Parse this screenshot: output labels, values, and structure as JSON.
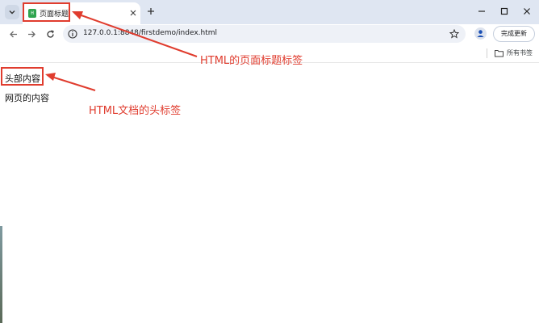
{
  "browser": {
    "tab": {
      "title": "页面标题",
      "favicon_text": "H"
    },
    "address_bar": {
      "url": "127.0.0.1:8848/firstdemo/index.html"
    },
    "update_button": "完成更新",
    "bookmarks": {
      "all_bookmarks_label": "所有书签"
    }
  },
  "page": {
    "heading": "头部内容",
    "body_text": "网页的内容"
  },
  "annotations": {
    "title_note": "HTML的页面标题标签",
    "head_note": "HTML文档的头标签"
  },
  "colors": {
    "annotation": "#e03c2e",
    "favicon": "#2fa44f",
    "titlebar": "#dfe6f2"
  },
  "icons": [
    "tab-search-icon",
    "close-icon",
    "plus-icon",
    "minimize-icon",
    "maximize-icon",
    "window-close-icon",
    "back-arrow-icon",
    "forward-arrow-icon",
    "reload-icon",
    "info-icon",
    "star-icon",
    "profile-icon",
    "folder-icon"
  ]
}
